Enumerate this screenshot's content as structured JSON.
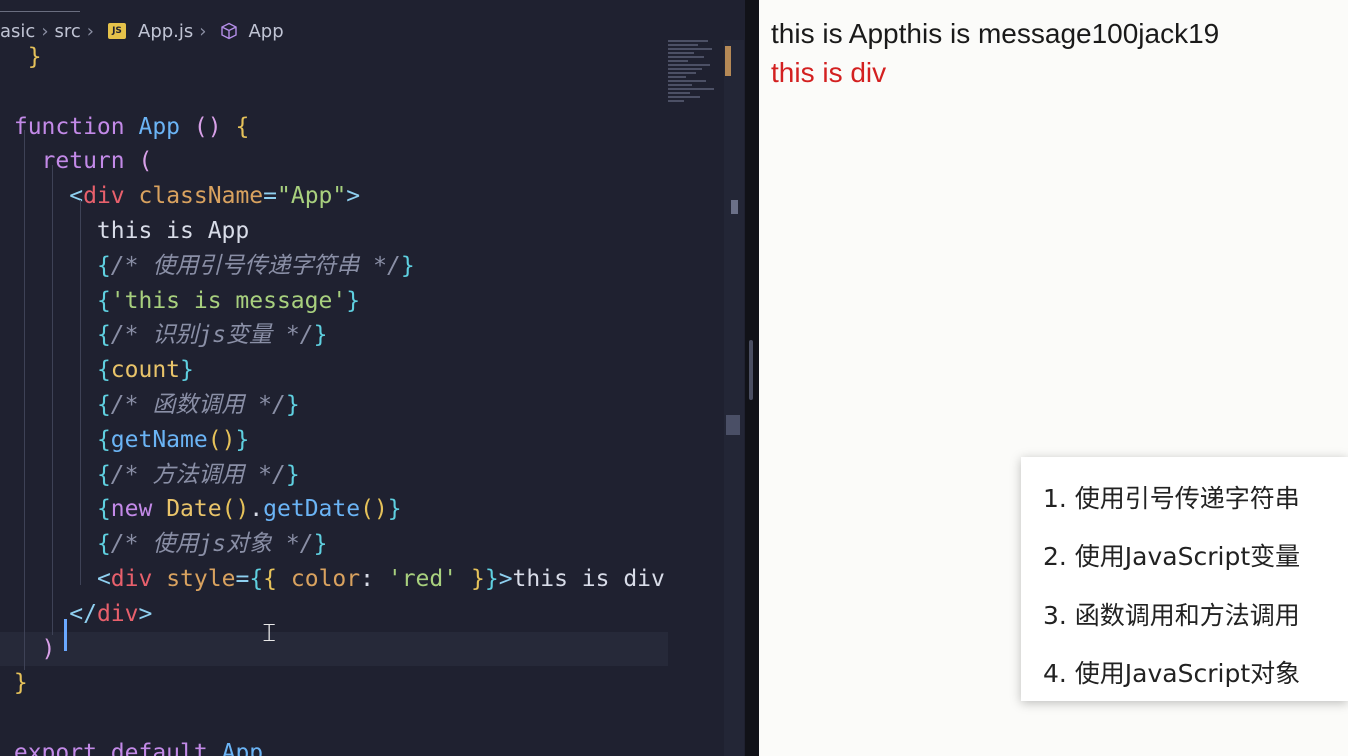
{
  "breadcrumb": {
    "segments": [
      "asic",
      "src",
      "App.js",
      "App"
    ],
    "file_badge": "JS"
  },
  "code_lines": [
    "}",
    "",
    "function App () {",
    "  return (",
    "    <div className=\"App\">",
    "      this is App",
    "      {/* 使用引号传递字符串 */}",
    "      {'this is message'}",
    "      {/* 识别js变量 */}",
    "      {count}",
    "      {/* 函数调用 */}",
    "      {getName()}",
    "      {/* 方法调用 */}",
    "      {new Date().getDate()}",
    "      {/* 使用js对象 */}",
    "      <div style={{ color: 'red' }}>this is div",
    "    </div>",
    "  )",
    "}",
    "",
    "export default App"
  ],
  "preview": {
    "line1": "this is Appthis is message100jack19",
    "line2": "this is div",
    "line2_color": "#d32020"
  },
  "notes": [
    "1. 使用引号传递字符串",
    "2. 使用JavaScript变量",
    "3. 函数调用和方法调用",
    "4. 使用JavaScript对象"
  ]
}
